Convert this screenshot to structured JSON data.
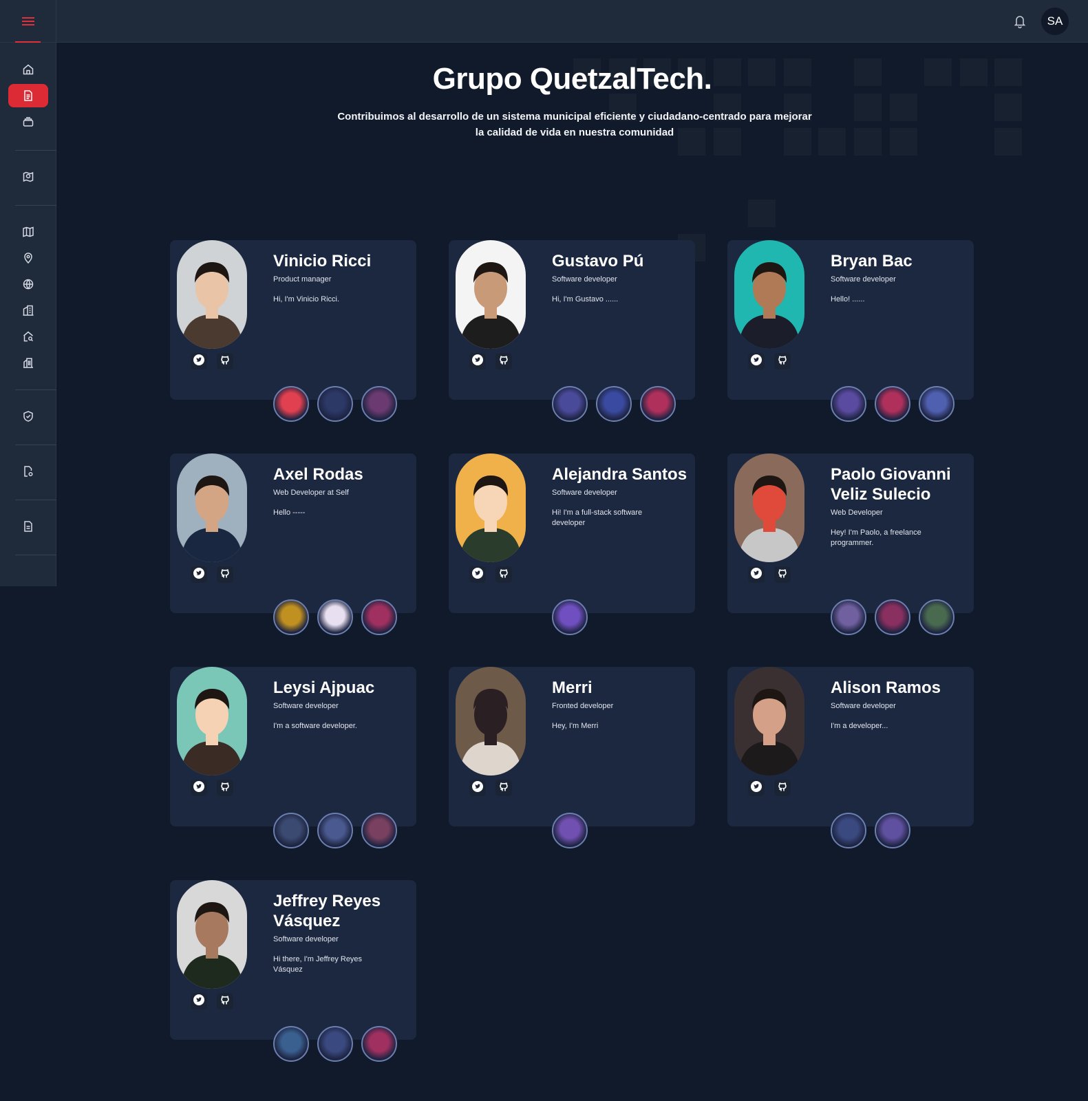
{
  "header": {
    "user_initials": "SA",
    "icons": [
      "menu-icon",
      "bell-icon"
    ]
  },
  "sidebar": {
    "items": [
      {
        "name": "home",
        "icon": "home-icon",
        "active": false
      },
      {
        "name": "documents",
        "icon": "document-icon",
        "active": true
      },
      {
        "name": "inbox",
        "icon": "inbox-icon",
        "active": false
      },
      {
        "name": "reports",
        "icon": "map-pin-check-icon",
        "active": false
      },
      {
        "name": "map",
        "icon": "map-icon",
        "active": false
      },
      {
        "name": "location",
        "icon": "location-pin-icon",
        "active": false
      },
      {
        "name": "globe",
        "icon": "globe-icon",
        "active": false
      },
      {
        "name": "buildings",
        "icon": "buildings-icon",
        "active": false
      },
      {
        "name": "home-search",
        "icon": "home-search-icon",
        "active": false
      },
      {
        "name": "city",
        "icon": "city-icon",
        "active": false
      },
      {
        "name": "security",
        "icon": "shield-check-icon",
        "active": false
      },
      {
        "name": "file-settings",
        "icon": "file-gear-icon",
        "active": false
      },
      {
        "name": "file",
        "icon": "file-icon",
        "active": false
      }
    ]
  },
  "hero": {
    "title": "Grupo QuetzalTech.",
    "subtitle_line1": "Contribuimos al desarrollo de un sistema municipal eficiente y ciudadano-centrado para mejorar",
    "subtitle_line2": "la calidad de vida en nuestra comunidad"
  },
  "members": [
    {
      "name": "Vinicio Ricci",
      "role": "Product manager",
      "bio": "Hi, I'm Vinicio Ricci.",
      "badge_count": 3
    },
    {
      "name": "Gustavo Pú",
      "role": "Software developer",
      "bio": "Hi, I'm Gustavo ......",
      "badge_count": 3
    },
    {
      "name": "Bryan Bac",
      "role": "Software developer",
      "bio": "Hello! ......",
      "badge_count": 3
    },
    {
      "name": "Axel Rodas",
      "role": "Web Developer at Self",
      "bio": "Hello -----",
      "badge_count": 3
    },
    {
      "name": "Alejandra Santos",
      "role": "Software developer",
      "bio": "Hi! I'm a full-stack software developer",
      "badge_count": 1
    },
    {
      "name": "Paolo Giovanni Veliz Sulecio",
      "role": "Web Developer",
      "bio": "Hey! I'm Paolo, a freelance programmer.",
      "badge_count": 3
    },
    {
      "name": "Leysi Ajpuac",
      "role": "Software developer",
      "bio": "I'm a software developer.",
      "badge_count": 3
    },
    {
      "name": "Merri",
      "role": "Fronted developer",
      "bio": "Hey, I'm Merri",
      "badge_count": 1
    },
    {
      "name": "Alison Ramos",
      "role": "Software developer",
      "bio": "I'm a developer...",
      "badge_count": 2
    },
    {
      "name": "Jeffrey Reyes Vásquez",
      "role": "Software developer",
      "bio": "Hi there, I'm Jeffrey Reyes Vásquez",
      "badge_count": 3
    }
  ],
  "social_icons": [
    "twitter-icon",
    "github-icon"
  ]
}
